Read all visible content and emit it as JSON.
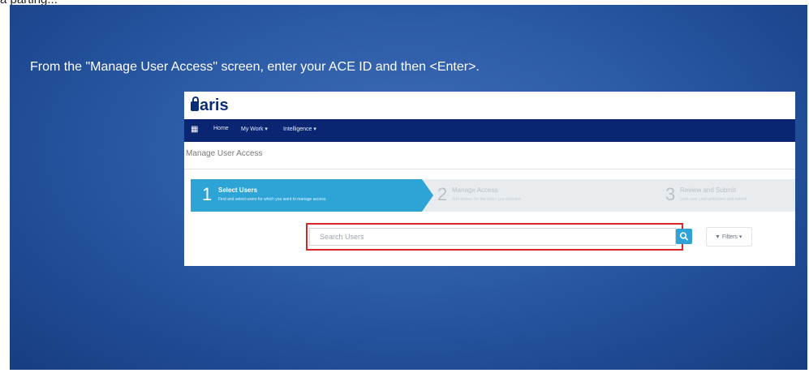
{
  "top_strip": {
    "text": "a parting..."
  },
  "slide": {
    "caption": "From the \"Manage User Access\" screen, enter your ACE ID and then <Enter>.",
    "colors": {
      "background": "#2b5aa6"
    }
  },
  "app": {
    "logo": "aris",
    "nav": {
      "grid_icon": "grid-icon",
      "items": [
        {
          "label": "Home"
        },
        {
          "label": "My Work ▾"
        },
        {
          "label": "Intelligence ▾"
        }
      ]
    },
    "page_title": "Manage User Access",
    "steps": [
      {
        "number": "1",
        "title": "Select Users",
        "subtitle": "Find and select users for which you want to manage access."
      },
      {
        "number": "2",
        "title": "Manage Access",
        "subtitle": "Add access for the users you selected"
      },
      {
        "number": "3",
        "title": "Review and Submit",
        "subtitle": "Look over your selections and submit"
      }
    ],
    "search": {
      "placeholder": "Search Users",
      "button_icon": "search-icon",
      "filters_label": "▼ Filters ▾"
    },
    "colors": {
      "navbar": "#0a2672",
      "accent": "#2ea3d6",
      "highlight": "#d9262b"
    }
  }
}
